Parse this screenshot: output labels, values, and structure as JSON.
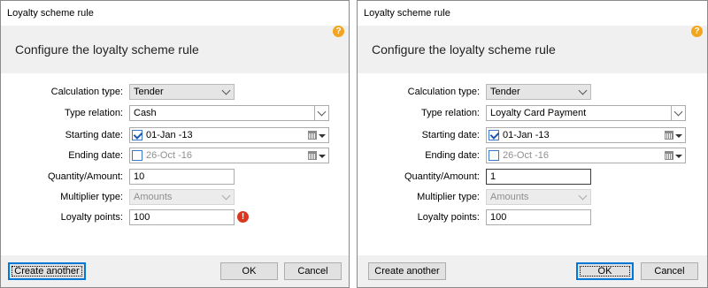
{
  "dialogs": [
    {
      "title": "Loyalty scheme rule",
      "header_title": "Configure the loyalty scheme rule",
      "help_icon": "?",
      "fields": {
        "calculation_type": {
          "label": "Calculation type:",
          "value": "Tender"
        },
        "type_relation": {
          "label": "Type relation:",
          "value": "Cash"
        },
        "starting_date": {
          "label": "Starting date:",
          "value": "01-Jan -13",
          "checked": true
        },
        "ending_date": {
          "label": "Ending date:",
          "value": "26-Oct -16",
          "checked": false
        },
        "quantity_amount": {
          "label": "Quantity/Amount:",
          "value": "10"
        },
        "multiplier_type": {
          "label": "Multiplier type:",
          "value": "Amounts"
        },
        "loyalty_points": {
          "label": "Loyalty points:",
          "value": "100"
        }
      },
      "error_icon": "!",
      "buttons": {
        "create_another": "Create another",
        "ok": "OK",
        "cancel": "Cancel"
      }
    },
    {
      "title": "Loyalty scheme rule",
      "header_title": "Configure the loyalty scheme rule",
      "help_icon": "?",
      "fields": {
        "calculation_type": {
          "label": "Calculation type:",
          "value": "Tender"
        },
        "type_relation": {
          "label": "Type relation:",
          "value": "Loyalty Card Payment"
        },
        "starting_date": {
          "label": "Starting date:",
          "value": "01-Jan -13",
          "checked": true
        },
        "ending_date": {
          "label": "Ending date:",
          "value": "26-Oct -16",
          "checked": false
        },
        "quantity_amount": {
          "label": "Quantity/Amount:",
          "value": "1"
        },
        "multiplier_type": {
          "label": "Multiplier type:",
          "value": "Amounts"
        },
        "loyalty_points": {
          "label": "Loyalty points:",
          "value": "100"
        }
      },
      "buttons": {
        "create_another": "Create another",
        "ok": "OK",
        "cancel": "Cancel"
      }
    }
  ],
  "icons": {
    "help": "help-icon",
    "error": "error-icon",
    "calendar": "calendar-icon",
    "checkbox": "checkbox-icon"
  },
  "colors": {
    "accent": "#0078d7",
    "help": "#f2a51e",
    "error": "#d9381e",
    "header_bg": "#f0f0f0"
  }
}
